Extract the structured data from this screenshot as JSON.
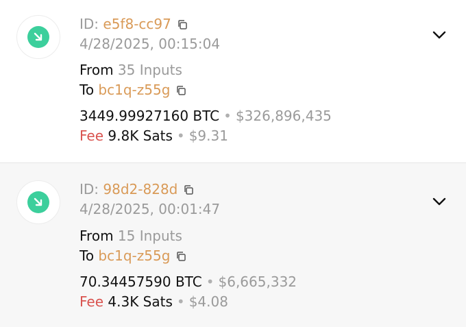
{
  "transactions": [
    {
      "id_label": "ID:",
      "id": "e5f8-cc97",
      "timestamp": "4/28/2025, 00:15:04",
      "from_label": "From",
      "from_value": "35 Inputs",
      "to_label": "To",
      "to_address": "bc1q-z55g",
      "amount_btc": "3449.99927160 BTC",
      "amount_usd": "$326,896,435",
      "fee_label": "Fee",
      "fee_sats": "9.8K Sats",
      "fee_usd": "$9.31",
      "direction_icon": "incoming-arrow-icon"
    },
    {
      "id_label": "ID:",
      "id": "98d2-828d",
      "timestamp": "4/28/2025, 00:01:47",
      "from_label": "From",
      "from_value": "15 Inputs",
      "to_label": "To",
      "to_address": "bc1q-z55g",
      "amount_btc": "70.34457590 BTC",
      "amount_usd": "$6,665,332",
      "fee_label": "Fee",
      "fee_sats": "4.3K Sats",
      "fee_usd": "$4.08",
      "direction_icon": "incoming-arrow-icon"
    }
  ],
  "colors": {
    "accent_green": "#3ccf9c",
    "link_orange": "#d99a57",
    "fee_red": "#d9534f"
  }
}
